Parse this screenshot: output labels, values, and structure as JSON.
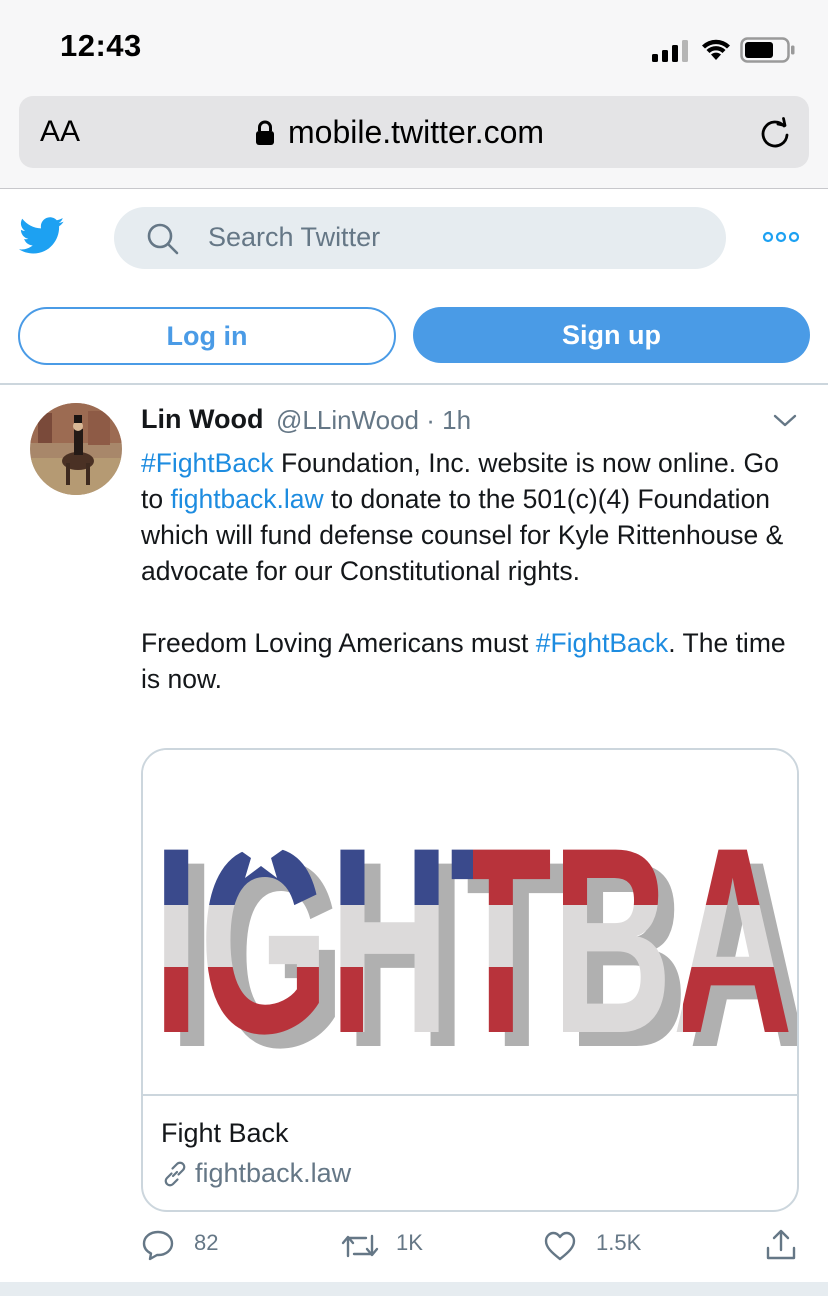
{
  "status_bar": {
    "time": "12:43"
  },
  "browser": {
    "text_size_label": "AA",
    "url": "mobile.twitter.com"
  },
  "header": {
    "search_placeholder": "Search Twitter"
  },
  "auth": {
    "login_label": "Log in",
    "signup_label": "Sign up"
  },
  "tweet": {
    "author_name": "Lin Wood",
    "handle_time": "@LLinWood · 1h",
    "p1_hashtag": "#FightBack",
    "p1_text_a": " Foundation, Inc. website is now online. Go to ",
    "p1_link": "fightback.law",
    "p1_text_b": " to donate to the 501(c)(4) Foundation which will fund defense counsel for Kyle Rittenhouse & advocate for our Constitutional rights.",
    "p2_text_a": "Freedom Loving Americans must ",
    "p2_hashtag": "#FightBack",
    "p2_text_b": ". The time is now."
  },
  "card": {
    "title": "Fight Back",
    "domain": "fightback.law",
    "image_text": "IGHTBA"
  },
  "actions": {
    "replies": "82",
    "retweets": "1K",
    "likes": "1.5K"
  },
  "colors": {
    "twitter_blue": "#1da1f2",
    "link": "#1d8ce0",
    "button_blue": "#4a9be6",
    "flag_red": "#b8333b",
    "flag_blue": "#3a4a8c"
  }
}
